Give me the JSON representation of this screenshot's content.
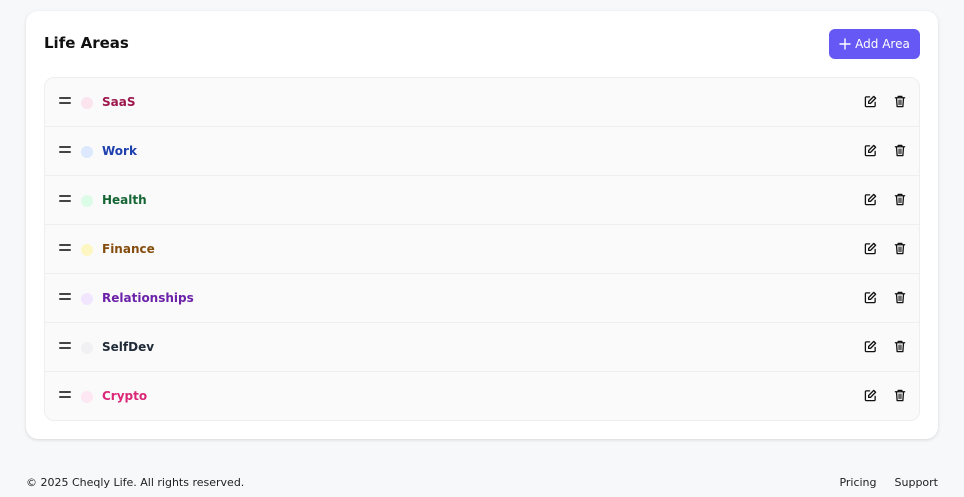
{
  "header": {
    "title": "Life Areas",
    "add_button_label": "Add Area"
  },
  "colors": {
    "accent": "#6558f5"
  },
  "areas": [
    {
      "name": "SaaS",
      "dot_color": "#fbe4ee",
      "text_color": "#9d174d"
    },
    {
      "name": "Work",
      "dot_color": "#dbe8fd",
      "text_color": "#1e40af"
    },
    {
      "name": "Health",
      "dot_color": "#dcfce7",
      "text_color": "#166534"
    },
    {
      "name": "Finance",
      "dot_color": "#fdf6c3",
      "text_color": "#854d0e"
    },
    {
      "name": "Relationships",
      "dot_color": "#f1e6fe",
      "text_color": "#6b21a8"
    },
    {
      "name": "SelfDev",
      "dot_color": "#f1f1f3",
      "text_color": "#1f2937"
    },
    {
      "name": "Crypto",
      "dot_color": "#fce7f3",
      "text_color": "#db2777"
    }
  ],
  "row_icons": [
    "drag-handle-icon",
    "edit-icon",
    "trash-icon"
  ],
  "footer": {
    "copyright": "© 2025 Cheqly Life. All rights reserved.",
    "links": [
      "Pricing",
      "Support"
    ]
  }
}
